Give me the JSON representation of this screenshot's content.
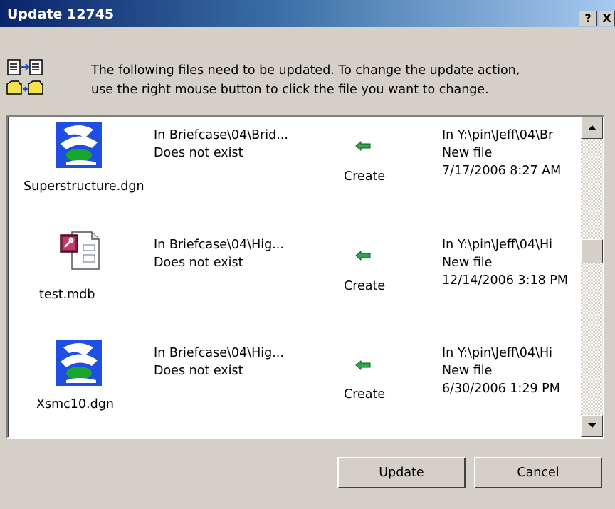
{
  "window": {
    "title": "Update 12745",
    "help_label": "?",
    "close_label": "X"
  },
  "message": {
    "line1": "The following files need to be updated. To change the update action,",
    "line2": "use the right mouse button to click the file you want to change."
  },
  "files": [
    {
      "name": "Superstructure.dgn",
      "icon": "dgn-file-icon",
      "briefcase_path": "In Briefcase\\04\\Brid...",
      "briefcase_status": "Does not exist",
      "action": "Create",
      "dest_path": "In Y:\\pin\\Jeff\\04\\Br",
      "dest_status": "New file",
      "dest_date": "7/17/2006 8:27 AM"
    },
    {
      "name": "test.mdb",
      "icon": "access-db-file-icon",
      "briefcase_path": "In Briefcase\\04\\Hig...",
      "briefcase_status": "Does not exist",
      "action": "Create",
      "dest_path": "In Y:\\pin\\Jeff\\04\\Hi",
      "dest_status": "New file",
      "dest_date": "12/14/2006 3:18 PM"
    },
    {
      "name": "Xsmc10.dgn",
      "icon": "dgn-file-icon",
      "briefcase_path": "In Briefcase\\04\\Hig...",
      "briefcase_status": "Does not exist",
      "action": "Create",
      "dest_path": "In Y:\\pin\\Jeff\\04\\Hi",
      "dest_status": "New file",
      "dest_date": "6/30/2006 1:29 PM"
    }
  ],
  "buttons": {
    "update_label": "Update",
    "cancel_label": "Cancel"
  },
  "colors": {
    "title_start": "#0a246a",
    "title_end": "#a6caf0",
    "face": "#d4d0c8",
    "arrow_green": "#2fa84f"
  }
}
